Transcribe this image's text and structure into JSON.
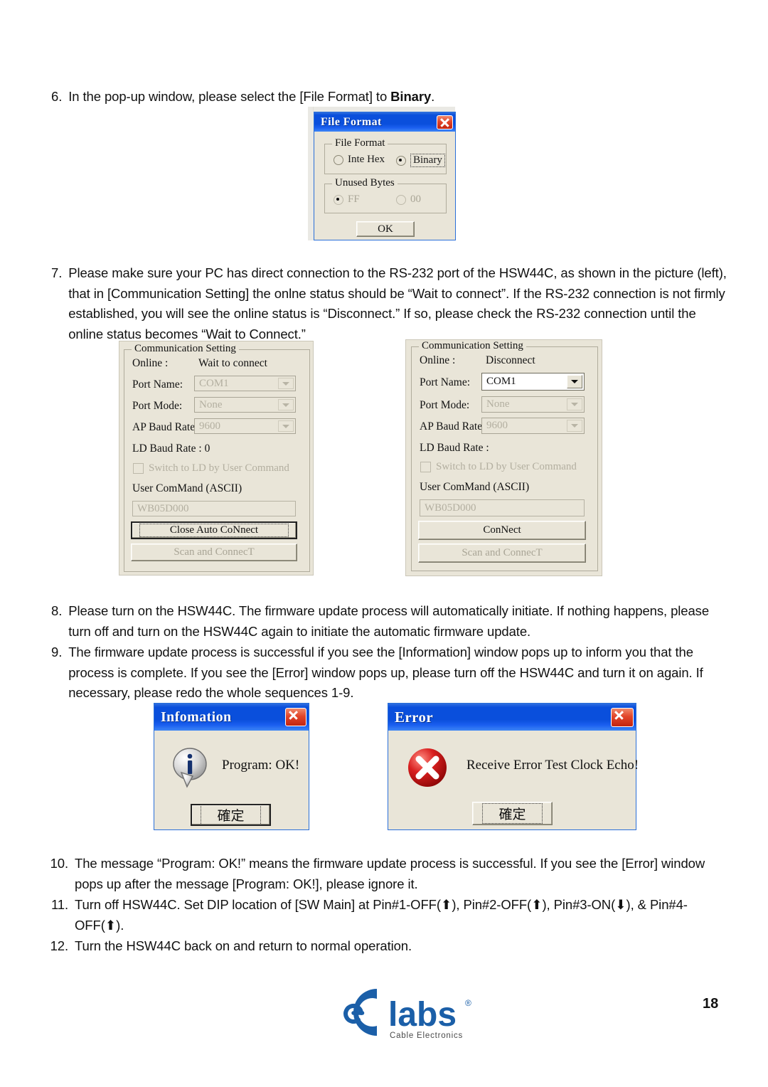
{
  "page": {
    "number": "18",
    "logo": {
      "wordmark": "labs",
      "tagline": "Cable Electronics",
      "registered": "®",
      "brand_color": "#1b5fa8"
    }
  },
  "steps": [
    {
      "num": "6.",
      "text_before": "In the pop-up window, please select the [File Format] to ",
      "bold": "Binary",
      "text_after": "."
    },
    {
      "num": "7.",
      "text": "Please make sure your PC has direct connection to the RS-232 port of the HSW44C, as shown in the picture (left), that in [Communication Setting] the onlne status should be “Wait to connect”. If the RS-232 connection is not firmly established, you will see the online status is “Disconnect.” If so, please check the RS-232 connection until the online status becomes “Wait to Connect.”"
    },
    {
      "num": "8.",
      "text": "Please turn on the HSW44C. The firmware update process will automatically initiate. If nothing happens, please turn off and turn on the HSW44C again to initiate the automatic firmware update."
    },
    {
      "num": "9.",
      "text": "The firmware update process is successful if you see the [Information] window pops up to inform you that the process is complete. If you see the [Error] window pops up, please turn off the HSW44C and turn it on again. If necessary, please redo the whole sequences 1-9."
    },
    {
      "num": "10.",
      "text": "The message “Program: OK!” means the firmware update process is successful. If you see the [Error] window pops up after the message [Program: OK!], please ignore it."
    },
    {
      "num": "11.",
      "text": "Turn off HSW44C. Set DIP location of [SW Main] at Pin#1-OFF(⬆), Pin#2-OFF(⬆), Pin#3-ON(⬇), & Pin#4-OFF(⬆)."
    },
    {
      "num": "12.",
      "text": "Turn the HSW44C back on and return to normal operation."
    }
  ],
  "file_format_dialog": {
    "title": "File Format",
    "close_icon": "close-icon",
    "group_format": {
      "legend": "File Format",
      "options": [
        {
          "label": "Inte Hex",
          "checked": false,
          "enabled": true,
          "focused": false
        },
        {
          "label": "Binary",
          "checked": true,
          "enabled": true,
          "focused": true
        }
      ]
    },
    "group_unused": {
      "legend": "Unused Bytes",
      "options": [
        {
          "label": "FF",
          "checked": true,
          "enabled": false,
          "focused": false
        },
        {
          "label": "00",
          "checked": false,
          "enabled": false,
          "focused": false
        }
      ]
    },
    "ok_label": "OK"
  },
  "comm_left": {
    "legend": "Communication Setting",
    "online_label": "Online :",
    "online_value": "Wait to connect",
    "port_name_label": "Port Name:",
    "port_name_value": "COM1",
    "port_name_enabled": false,
    "port_mode_label": "Port Mode:",
    "port_mode_value": "None",
    "ap_baud_label": "AP Baud Rate:",
    "ap_baud_value": "9600",
    "ld_baud_label": "LD Baud Rate : 0",
    "switch_checkbox": "Switch to LD by User Command",
    "user_command_label": "User ComMand (ASCII)",
    "user_command_value": "WB05D000",
    "primary_button": "Close Auto CoNnect",
    "secondary_button": "Scan and ConnecT"
  },
  "comm_right": {
    "legend": "Communication Setting",
    "online_label": "Online :",
    "online_value": "Disconnect",
    "port_name_label": "Port Name:",
    "port_name_value": "COM1",
    "port_name_enabled": true,
    "port_mode_label": "Port Mode:",
    "port_mode_value": "None",
    "ap_baud_label": "AP Baud Rate:",
    "ap_baud_value": "9600",
    "ld_baud_label": "LD Baud Rate :",
    "switch_checkbox": "Switch to LD by User Command",
    "user_command_label": "User ComMand (ASCII)",
    "user_command_value": "WB05D000",
    "primary_button": "ConNect",
    "secondary_button": "Scan and ConnecT"
  },
  "information_dialog": {
    "title": "Infomation",
    "icon": "info-icon",
    "message": "Program: OK!",
    "ok_label": "確定"
  },
  "error_dialog": {
    "title": "Error",
    "icon": "error-icon",
    "message": "Receive Error Test Clock Echo!",
    "ok_label": "確定"
  }
}
